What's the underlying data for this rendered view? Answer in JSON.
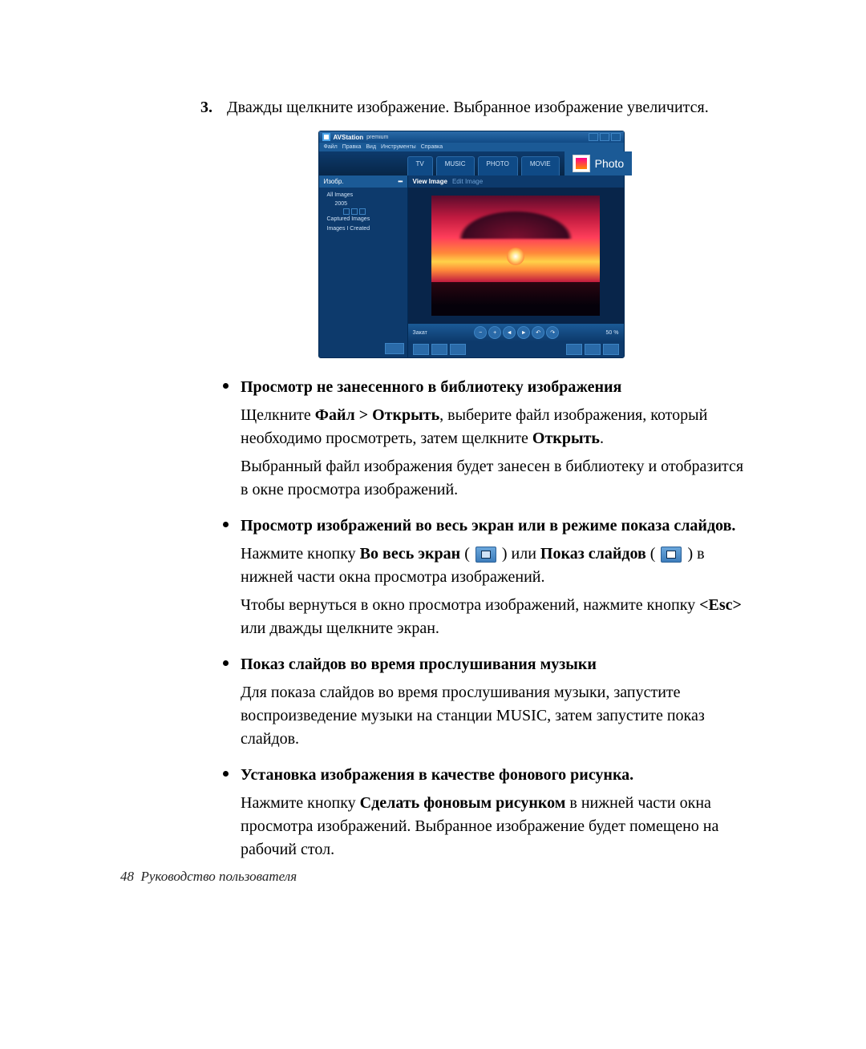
{
  "step": {
    "num": "3.",
    "text": "Дважды щелкните изображение. Выбранное изображение увеличится."
  },
  "app": {
    "title": "AVStation",
    "title_suffix": "premium",
    "menu": [
      "Файл",
      "Правка",
      "Вид",
      "Инструменты",
      "Справка"
    ],
    "tabs": [
      "TV",
      "MUSIC",
      "PHOTO",
      "MOVIE"
    ],
    "mode": "Photo",
    "sidebar_header": "Изобр.",
    "tree": {
      "all": "All Images",
      "year": "2005",
      "captured": "Captured Images",
      "created": "Images I Created"
    },
    "viewtabs": {
      "active": "View Image",
      "inactive": "Edit Image"
    },
    "image_name": "Закат",
    "zoom": "50 %"
  },
  "bullets": [
    {
      "head": "Просмотр не занесенного в библиотеку изображения",
      "paras": [
        {
          "parts": [
            {
              "t": "Щелкните "
            },
            {
              "b": true,
              "t": "Файл > Открыть"
            },
            {
              "t": ", выберите файл изображения, который необходимо просмотреть, затем щелкните "
            },
            {
              "b": true,
              "t": "Открыть"
            },
            {
              "t": "."
            }
          ]
        },
        {
          "parts": [
            {
              "t": "Выбранный файл изображения будет занесен в библиотеку и отобразится в окне просмотра изображений."
            }
          ]
        }
      ]
    },
    {
      "head": "Просмотр изображений во весь экран или в режиме показа слайдов.",
      "paras": [
        {
          "parts": [
            {
              "t": "Нажмите кнопку "
            },
            {
              "b": true,
              "t": "Во весь экран"
            },
            {
              "t": " ( "
            },
            {
              "icon": "fs"
            },
            {
              "t": " ) или "
            },
            {
              "b": true,
              "t": "Показ слайдов"
            },
            {
              "t": " ( "
            },
            {
              "icon": "ss"
            },
            {
              "t": " ) в нижней части окна просмотра изображений."
            }
          ]
        },
        {
          "parts": [
            {
              "t": "Чтобы вернуться в окно просмотра изображений, нажмите кнопку "
            },
            {
              "b": true,
              "t": "<Esc>"
            },
            {
              "t": " или дважды щелкните экран."
            }
          ]
        }
      ]
    },
    {
      "head": "Показ слайдов во время прослушивания музыки",
      "paras": [
        {
          "parts": [
            {
              "t": "Для показа слайдов во время прослушивания музыки, запустите воспроизведение музыки на станции MUSIC, затем запустите показ слайдов."
            }
          ]
        }
      ]
    },
    {
      "head": "Установка изображения в качестве фонового рисунка.",
      "paras": [
        {
          "parts": [
            {
              "t": "Нажмите кнопку "
            },
            {
              "b": true,
              "t": "Сделать фоновым рисунком"
            },
            {
              "t": " в нижней части окна просмотра изображений. Выбранное изображение будет помещено на рабочий стол."
            }
          ]
        }
      ]
    }
  ],
  "footer": {
    "page": "48",
    "title": "Руководство пользователя"
  }
}
